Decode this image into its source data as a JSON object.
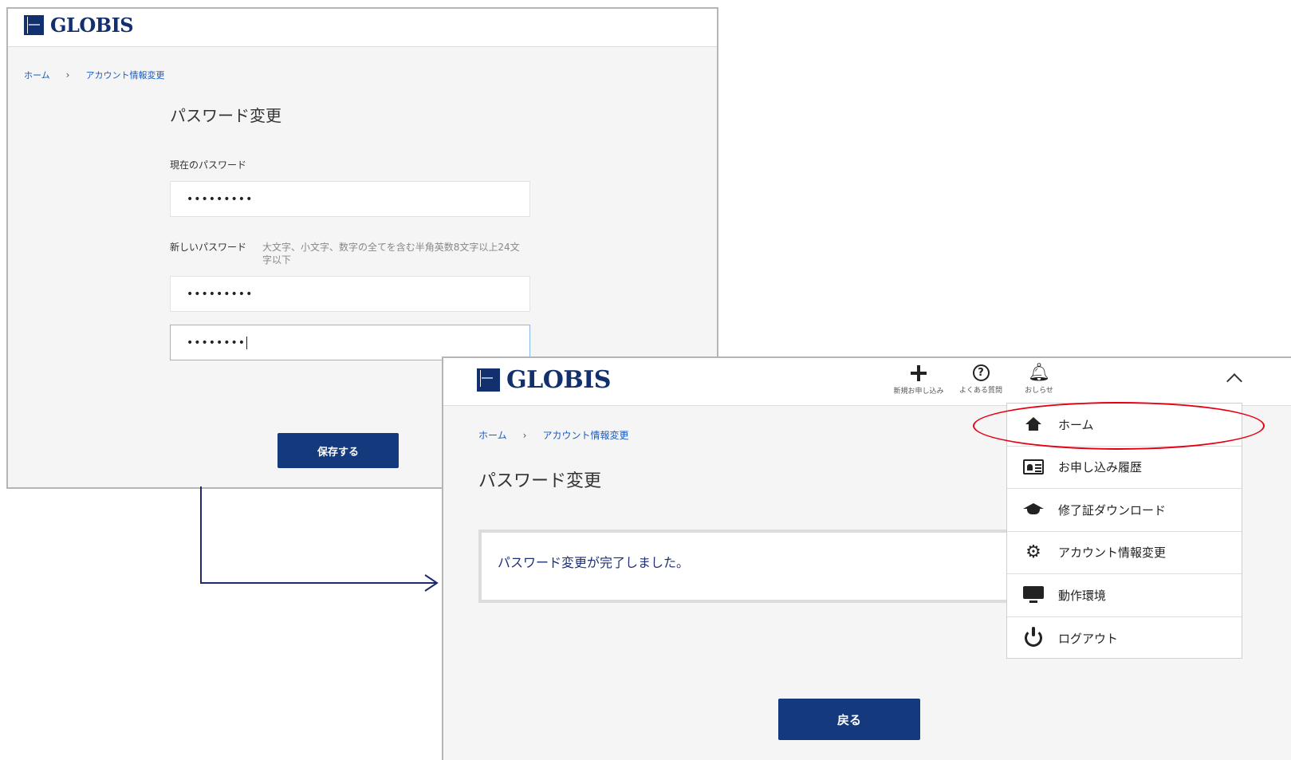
{
  "screen1": {
    "logo_text": "GLOBIS",
    "breadcrumb": [
      "ホーム",
      "アカウント情報変更"
    ],
    "page_title": "パスワード変更",
    "current_password_label": "現在のパスワード",
    "current_password_value": "•••••••••",
    "new_password_label": "新しいパスワード",
    "new_password_hint": "大文字、小文字、数字の全てを含む半角英数8文字以上24文字以下",
    "new_password_value": "•••••••••",
    "confirm_password_value": "••••••••",
    "save_label": "保存する"
  },
  "screen2": {
    "logo_text": "GLOBIS",
    "header_icons": [
      {
        "icon": "plus-icon",
        "label": "新規お申し込み"
      },
      {
        "icon": "help-icon",
        "label": "よくある質問"
      },
      {
        "icon": "bell-icon",
        "label": "おしらせ"
      }
    ],
    "breadcrumb": [
      "ホーム",
      "アカウント情報変更"
    ],
    "page_title": "パスワード変更",
    "notice": "パスワード変更が完了しました。",
    "back_label": "戻る",
    "menu": [
      {
        "icon": "home-icon",
        "label": "ホーム"
      },
      {
        "icon": "id-card-icon",
        "label": "お申し込み履歴"
      },
      {
        "icon": "graduation-cap-icon",
        "label": "修了証ダウンロード"
      },
      {
        "icon": "gear-icon",
        "label": "アカウント情報変更"
      },
      {
        "icon": "monitor-icon",
        "label": "動作環境"
      },
      {
        "icon": "power-icon",
        "label": "ログアウト"
      }
    ]
  },
  "colors": {
    "brand_navy": "#14397d",
    "link_blue": "#1a5bc4",
    "highlight_red": "#e60012",
    "arrow_navy": "#1d2a6b"
  }
}
